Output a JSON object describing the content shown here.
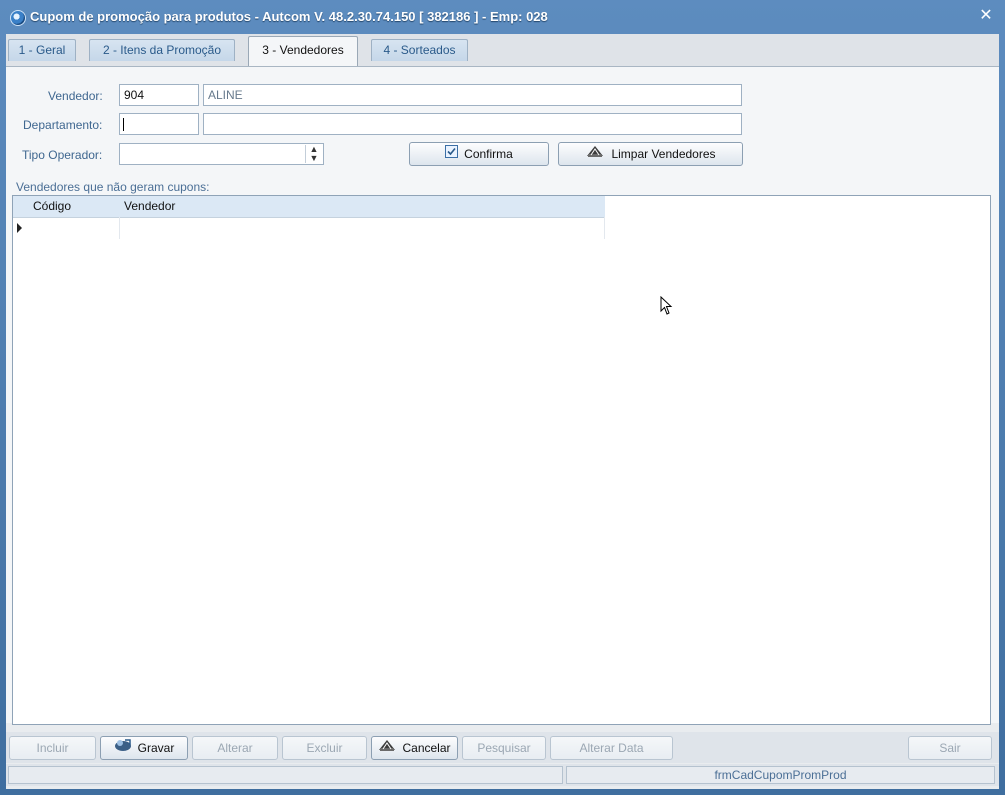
{
  "window": {
    "title": "Cupom de promoção para produtos   -   Autcom V. 48.2.30.74.150 [ 382186 ] - Emp: 028",
    "close_glyph": "✕"
  },
  "tabs": [
    {
      "label": "1 - Geral"
    },
    {
      "label": "2 - Itens da Promoção"
    },
    {
      "label": "3 - Vendedores",
      "active": true
    },
    {
      "label": "4 - Sorteados"
    }
  ],
  "form": {
    "vendedor_label": "Vendedor:",
    "vendedor_code": "904",
    "vendedor_name": "ALINE",
    "departamento_label": "Departamento:",
    "departamento_code": "",
    "departamento_name": "",
    "tipo_operador_label": "Tipo Operador:",
    "tipo_operador_value": "",
    "confirma_label": "Confirma",
    "limpar_label": "Limpar Vendedores"
  },
  "grid": {
    "title": "Vendedores que não geram cupons:",
    "columns": [
      "Código",
      "Vendedor"
    ]
  },
  "toolbar": {
    "incluir": "Incluir",
    "gravar": "Gravar",
    "alterar": "Alterar",
    "excluir": "Excluir",
    "cancelar": "Cancelar",
    "pesquisar": "Pesquisar",
    "alterar_data": "Alterar Data",
    "sair": "Sair"
  },
  "status": {
    "form_name": "frmCadCupomPromProd"
  },
  "icons": {
    "app": "app-logo-icon",
    "confirma": "checkbox-icon",
    "limpar": "broom-icon",
    "gravar": "save-icon",
    "cancelar": "cancel-icon",
    "cursor": "mouse-pointer-icon"
  }
}
